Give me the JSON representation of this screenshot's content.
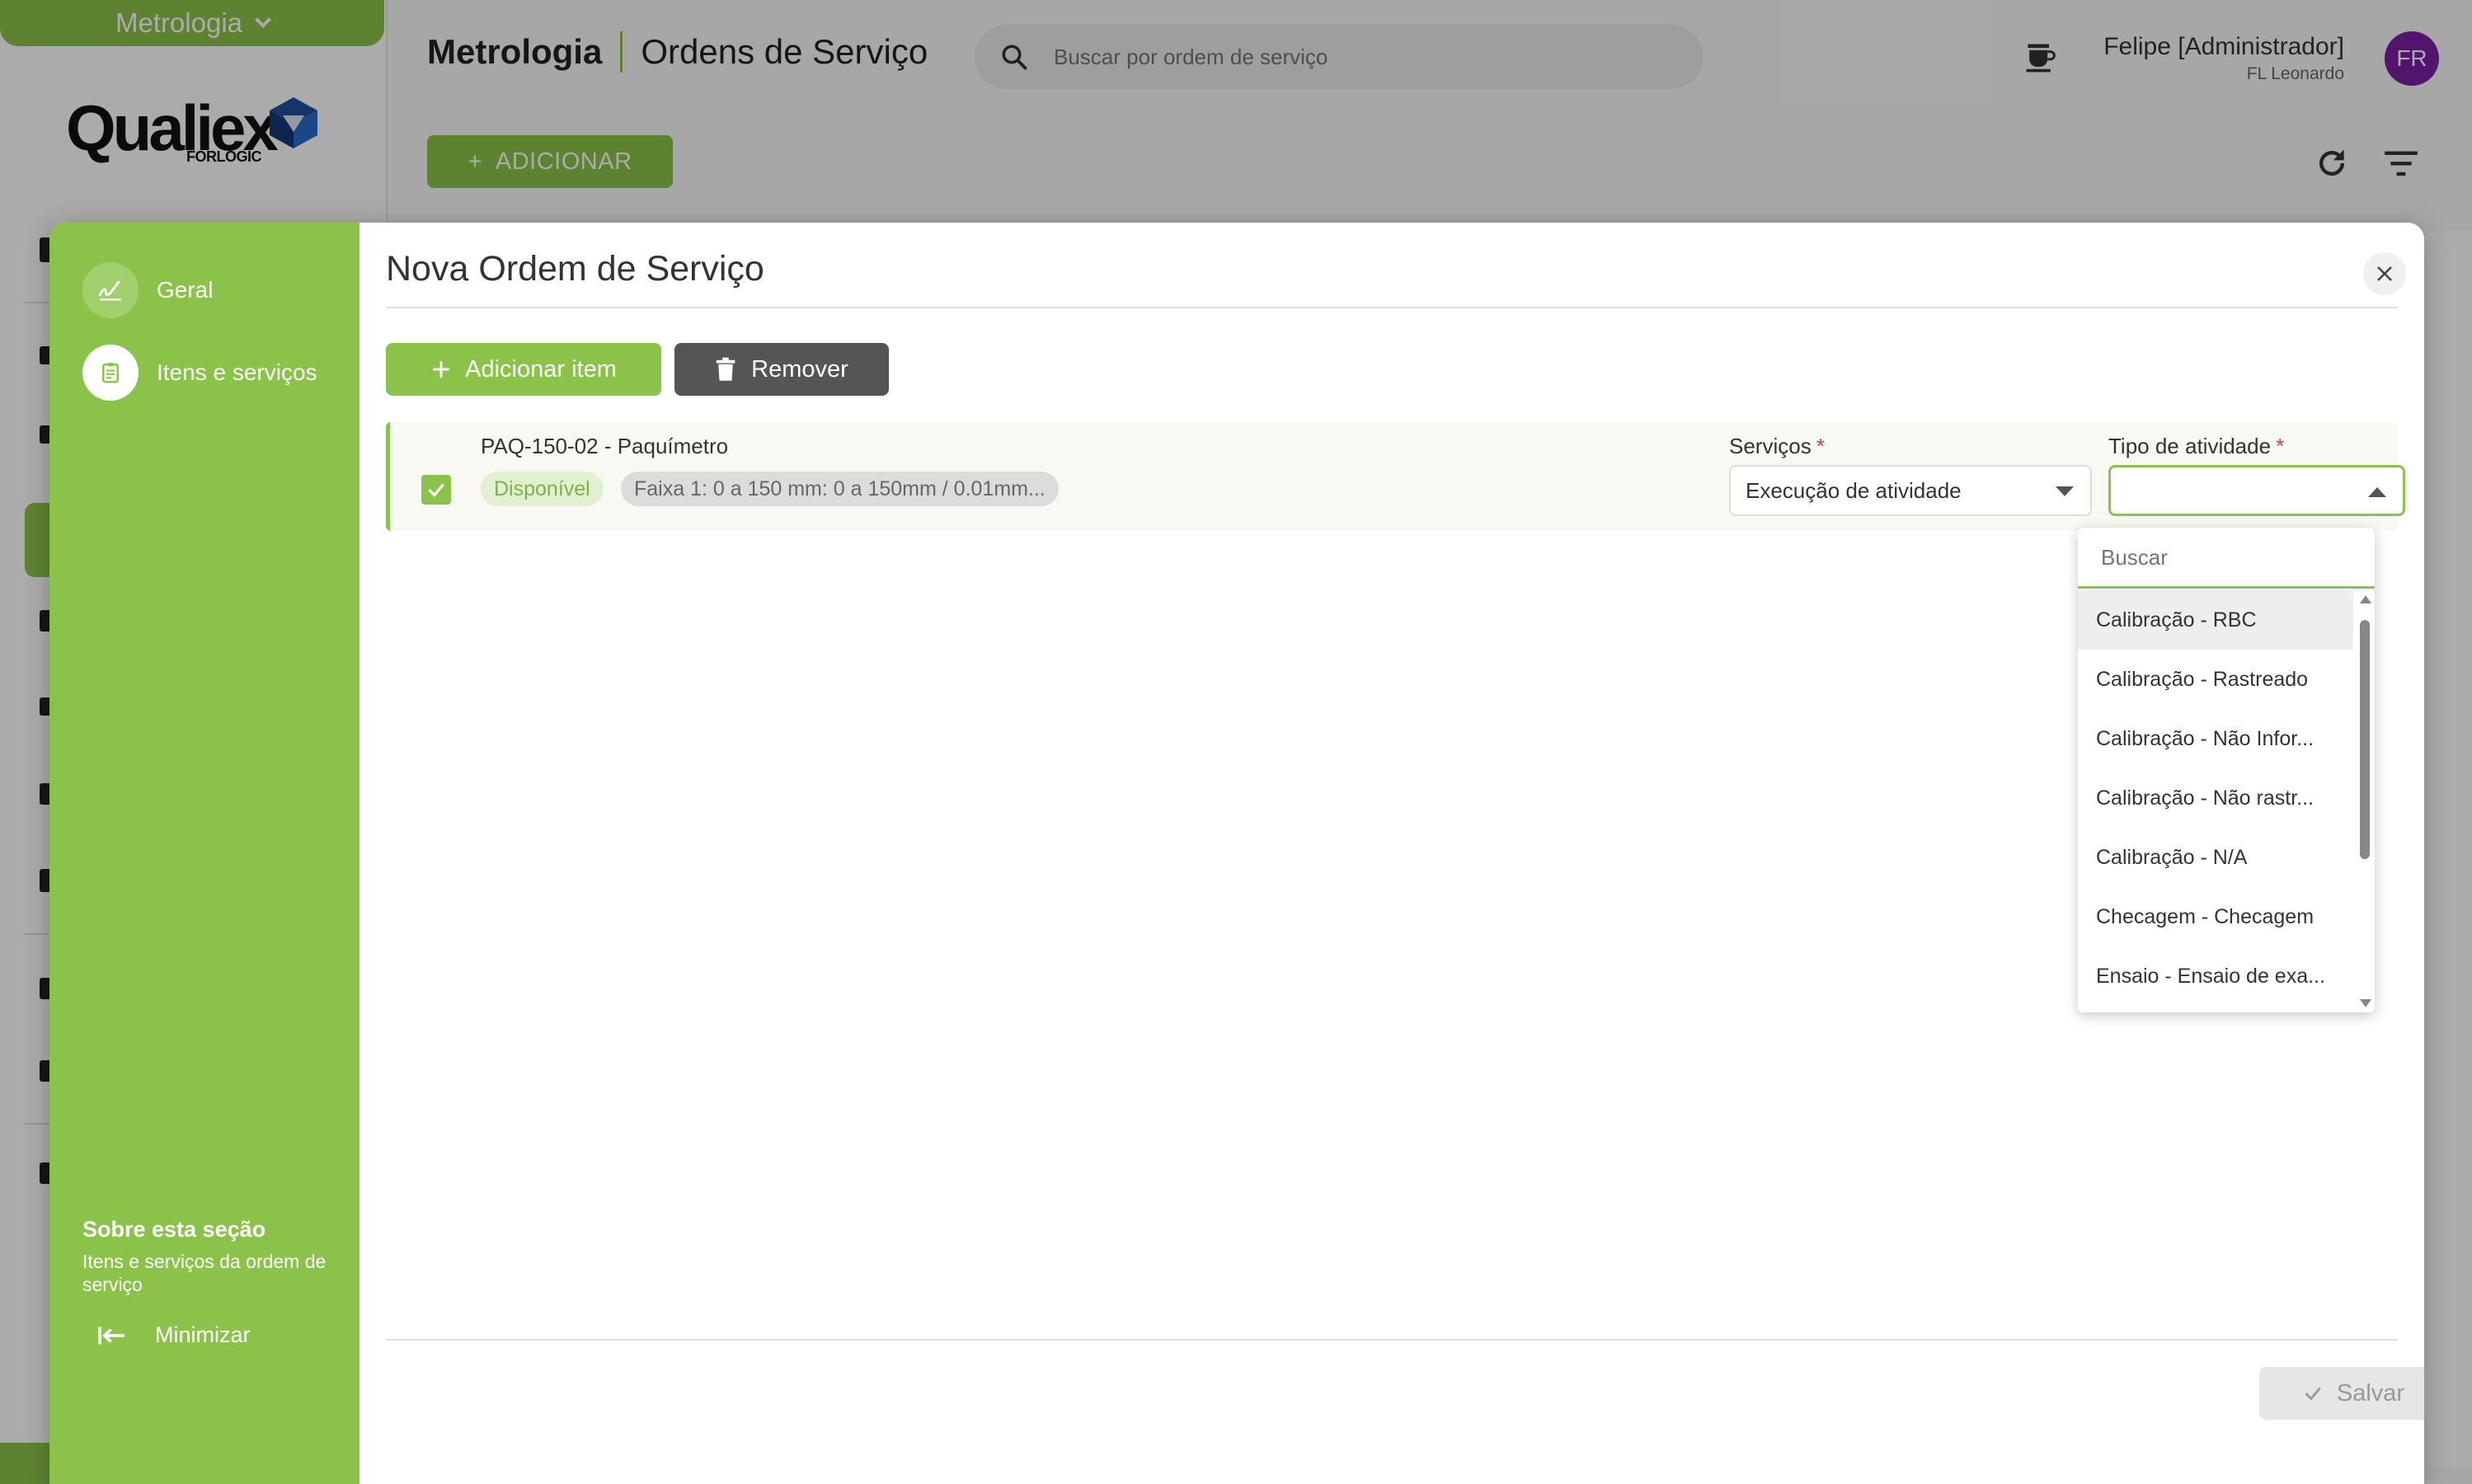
{
  "app": {
    "module_switch": "Metrologia",
    "brand": {
      "name": "Qualiex",
      "sub": "FORLOGIC"
    },
    "breadcrumb": {
      "module": "Metrologia",
      "page": "Ordens de Serviço"
    },
    "search": {
      "placeholder": "Buscar por ordem de serviço"
    },
    "user": {
      "name": "Felipe [Administrador]",
      "company": "FL Leonardo",
      "initials": "FR"
    },
    "add_button": "ADICIONAR",
    "colors": {
      "brand": "#8bc34a",
      "avatar": "#7b1fa2"
    }
  },
  "modal": {
    "title": "Nova Ordem de Serviço",
    "steps": [
      {
        "label": "Geral",
        "icon": "signature-icon"
      },
      {
        "label": "Itens e serviços",
        "icon": "clipboard-icon"
      }
    ],
    "about": {
      "title": "Sobre esta seção",
      "text": "Itens e serviços da ordem de serviço"
    },
    "minimize_label": "Minimizar",
    "toolbar": {
      "add_item": "Adicionar item",
      "remove": "Remover"
    },
    "item": {
      "name": "PAQ-150-02 - Paquímetro",
      "status": "Disponível",
      "range": "Faixa 1: 0 a 150 mm: 0 a 150mm / 0.01mm...",
      "checked": true
    },
    "services": {
      "label": "Serviços",
      "value": "Execução de atividade"
    },
    "activity": {
      "label": "Tipo de atividade",
      "value": "",
      "search_placeholder": "Buscar",
      "options": [
        "Calibração - RBC",
        "Calibração - Rastreado",
        "Calibração - Não Infor...",
        "Calibração - Não rastr...",
        "Calibração - N/A",
        "Checagem - Checagem",
        "Ensaio - Ensaio de exa..."
      ]
    },
    "save_label": "Salvar"
  }
}
